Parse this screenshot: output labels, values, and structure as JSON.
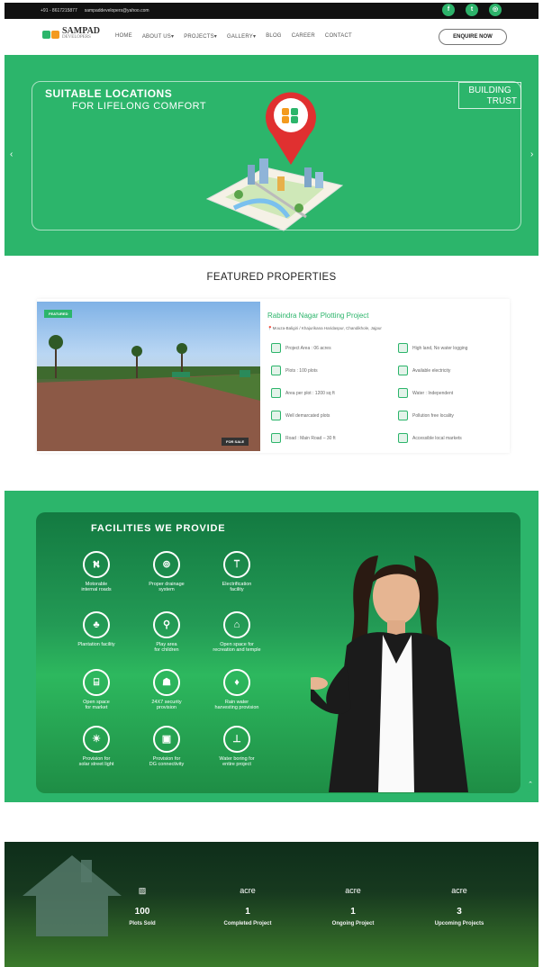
{
  "topbar": {
    "phone": "+91 - 8617215877",
    "email": "sampaddevelopers@yahoo.com"
  },
  "brand": {
    "name": "SAMPAD",
    "sub": "DEVELOPERS",
    "tagline": "BUILDING TRUST SINCE 2003",
    "green": "#2cb56b",
    "orange": "#f39a1e"
  },
  "nav": {
    "items": [
      "HOME",
      "ABOUT US▾",
      "PROJECTS▾",
      "GALLERY▾",
      "BLOG",
      "CAREER",
      "CONTACT"
    ],
    "enquire": "ENQUIRE NOW"
  },
  "hero": {
    "line1": "SUITABLE LOCATIONS",
    "line2": "FOR LIFELONG COMFORT",
    "badge1": "BUILDING",
    "badge2": "TRUST",
    "prev": "‹",
    "next": "›"
  },
  "featured": {
    "heading": "FEATURED PROPERTIES",
    "tag_featured": "FEATURED",
    "tag_sale": "FOR SALE",
    "title": "Rabindra Nagar Plotting Project",
    "location": "Mouza-Baligiri / Khajurikana Haridaspur, Chandikhole, Jajpur",
    "features_left": [
      "Project Area : 06 acres",
      "Plots : 100 plots",
      "Area per plot : 1200 sq ft",
      "Well demarcated plots",
      "Road : Main Road – 30 ft"
    ],
    "features_right": [
      "High land, No water logging",
      "Available electricity",
      "Water : Independent",
      "Pollution free locality",
      "Accessible local markets"
    ]
  },
  "facilities": {
    "heading": "FACILITIES WE PROVIDE",
    "items": [
      {
        "label1": "Motorable",
        "label2": "internal roads",
        "icon": "road-icon"
      },
      {
        "label1": "Proper drainage",
        "label2": "system",
        "icon": "drainage-icon"
      },
      {
        "label1": "Electrification",
        "label2": "facility",
        "icon": "electric-pole-icon"
      },
      {
        "label1": "Plantation facility",
        "label2": "",
        "icon": "tree-icon"
      },
      {
        "label1": "Play area",
        "label2": "for children",
        "icon": "playground-icon"
      },
      {
        "label1": "Open space for",
        "label2": "recreation and temple",
        "icon": "temple-icon"
      },
      {
        "label1": "Open space",
        "label2": "for market",
        "icon": "market-icon"
      },
      {
        "label1": "24X7 security",
        "label2": "provision",
        "icon": "security-icon"
      },
      {
        "label1": "Rain water",
        "label2": "harvesting provision",
        "icon": "water-drop-icon"
      },
      {
        "label1": "Provision for",
        "label2": "solar street light",
        "icon": "street-light-icon"
      },
      {
        "label1": "Provision for",
        "label2": "DG connectivity",
        "icon": "generator-icon"
      },
      {
        "label1": "Water boring for",
        "label2": "entire project",
        "icon": "water-boring-icon"
      }
    ]
  },
  "stats": [
    {
      "num": "100",
      "label": "Plots Sold",
      "icon": "plot-icon"
    },
    {
      "num": "1",
      "label": "Completed Project",
      "icon": "acre-icon"
    },
    {
      "num": "1",
      "label": "Ongoing Project",
      "icon": "acre-icon"
    },
    {
      "num": "3",
      "label": "Upcoming Projects",
      "icon": "acre-icon"
    }
  ],
  "stat_icon_text": "acre",
  "scroll_top": "⌃"
}
